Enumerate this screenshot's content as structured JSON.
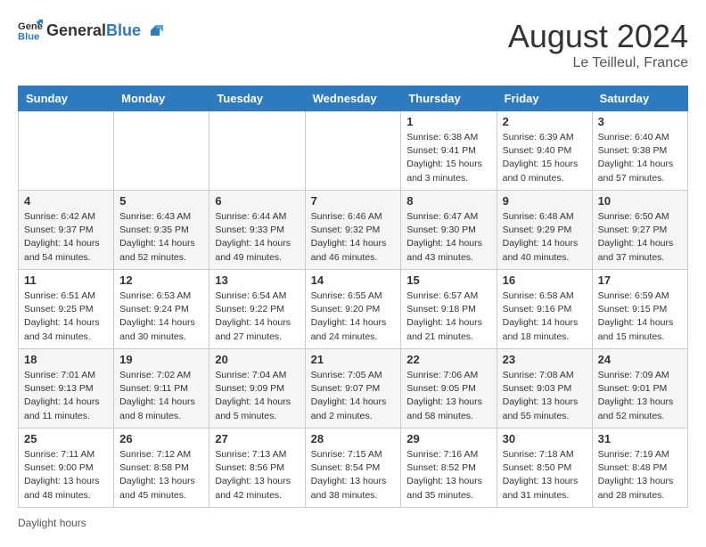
{
  "header": {
    "logo_general": "General",
    "logo_blue": "Blue",
    "month_year": "August 2024",
    "location": "Le Teilleul, France"
  },
  "days_of_week": [
    "Sunday",
    "Monday",
    "Tuesday",
    "Wednesday",
    "Thursday",
    "Friday",
    "Saturday"
  ],
  "weeks": [
    [
      {
        "day": "",
        "info": ""
      },
      {
        "day": "",
        "info": ""
      },
      {
        "day": "",
        "info": ""
      },
      {
        "day": "",
        "info": ""
      },
      {
        "day": "1",
        "info": "Sunrise: 6:38 AM\nSunset: 9:41 PM\nDaylight: 15 hours\nand 3 minutes."
      },
      {
        "day": "2",
        "info": "Sunrise: 6:39 AM\nSunset: 9:40 PM\nDaylight: 15 hours\nand 0 minutes."
      },
      {
        "day": "3",
        "info": "Sunrise: 6:40 AM\nSunset: 9:38 PM\nDaylight: 14 hours\nand 57 minutes."
      }
    ],
    [
      {
        "day": "4",
        "info": "Sunrise: 6:42 AM\nSunset: 9:37 PM\nDaylight: 14 hours\nand 54 minutes."
      },
      {
        "day": "5",
        "info": "Sunrise: 6:43 AM\nSunset: 9:35 PM\nDaylight: 14 hours\nand 52 minutes."
      },
      {
        "day": "6",
        "info": "Sunrise: 6:44 AM\nSunset: 9:33 PM\nDaylight: 14 hours\nand 49 minutes."
      },
      {
        "day": "7",
        "info": "Sunrise: 6:46 AM\nSunset: 9:32 PM\nDaylight: 14 hours\nand 46 minutes."
      },
      {
        "day": "8",
        "info": "Sunrise: 6:47 AM\nSunset: 9:30 PM\nDaylight: 14 hours\nand 43 minutes."
      },
      {
        "day": "9",
        "info": "Sunrise: 6:48 AM\nSunset: 9:29 PM\nDaylight: 14 hours\nand 40 minutes."
      },
      {
        "day": "10",
        "info": "Sunrise: 6:50 AM\nSunset: 9:27 PM\nDaylight: 14 hours\nand 37 minutes."
      }
    ],
    [
      {
        "day": "11",
        "info": "Sunrise: 6:51 AM\nSunset: 9:25 PM\nDaylight: 14 hours\nand 34 minutes."
      },
      {
        "day": "12",
        "info": "Sunrise: 6:53 AM\nSunset: 9:24 PM\nDaylight: 14 hours\nand 30 minutes."
      },
      {
        "day": "13",
        "info": "Sunrise: 6:54 AM\nSunset: 9:22 PM\nDaylight: 14 hours\nand 27 minutes."
      },
      {
        "day": "14",
        "info": "Sunrise: 6:55 AM\nSunset: 9:20 PM\nDaylight: 14 hours\nand 24 minutes."
      },
      {
        "day": "15",
        "info": "Sunrise: 6:57 AM\nSunset: 9:18 PM\nDaylight: 14 hours\nand 21 minutes."
      },
      {
        "day": "16",
        "info": "Sunrise: 6:58 AM\nSunset: 9:16 PM\nDaylight: 14 hours\nand 18 minutes."
      },
      {
        "day": "17",
        "info": "Sunrise: 6:59 AM\nSunset: 9:15 PM\nDaylight: 14 hours\nand 15 minutes."
      }
    ],
    [
      {
        "day": "18",
        "info": "Sunrise: 7:01 AM\nSunset: 9:13 PM\nDaylight: 14 hours\nand 11 minutes."
      },
      {
        "day": "19",
        "info": "Sunrise: 7:02 AM\nSunset: 9:11 PM\nDaylight: 14 hours\nand 8 minutes."
      },
      {
        "day": "20",
        "info": "Sunrise: 7:04 AM\nSunset: 9:09 PM\nDaylight: 14 hours\nand 5 minutes."
      },
      {
        "day": "21",
        "info": "Sunrise: 7:05 AM\nSunset: 9:07 PM\nDaylight: 14 hours\nand 2 minutes."
      },
      {
        "day": "22",
        "info": "Sunrise: 7:06 AM\nSunset: 9:05 PM\nDaylight: 13 hours\nand 58 minutes."
      },
      {
        "day": "23",
        "info": "Sunrise: 7:08 AM\nSunset: 9:03 PM\nDaylight: 13 hours\nand 55 minutes."
      },
      {
        "day": "24",
        "info": "Sunrise: 7:09 AM\nSunset: 9:01 PM\nDaylight: 13 hours\nand 52 minutes."
      }
    ],
    [
      {
        "day": "25",
        "info": "Sunrise: 7:11 AM\nSunset: 9:00 PM\nDaylight: 13 hours\nand 48 minutes."
      },
      {
        "day": "26",
        "info": "Sunrise: 7:12 AM\nSunset: 8:58 PM\nDaylight: 13 hours\nand 45 minutes."
      },
      {
        "day": "27",
        "info": "Sunrise: 7:13 AM\nSunset: 8:56 PM\nDaylight: 13 hours\nand 42 minutes."
      },
      {
        "day": "28",
        "info": "Sunrise: 7:15 AM\nSunset: 8:54 PM\nDaylight: 13 hours\nand 38 minutes."
      },
      {
        "day": "29",
        "info": "Sunrise: 7:16 AM\nSunset: 8:52 PM\nDaylight: 13 hours\nand 35 minutes."
      },
      {
        "day": "30",
        "info": "Sunrise: 7:18 AM\nSunset: 8:50 PM\nDaylight: 13 hours\nand 31 minutes."
      },
      {
        "day": "31",
        "info": "Sunrise: 7:19 AM\nSunset: 8:48 PM\nDaylight: 13 hours\nand 28 minutes."
      }
    ]
  ],
  "footer_text": "Daylight hours"
}
